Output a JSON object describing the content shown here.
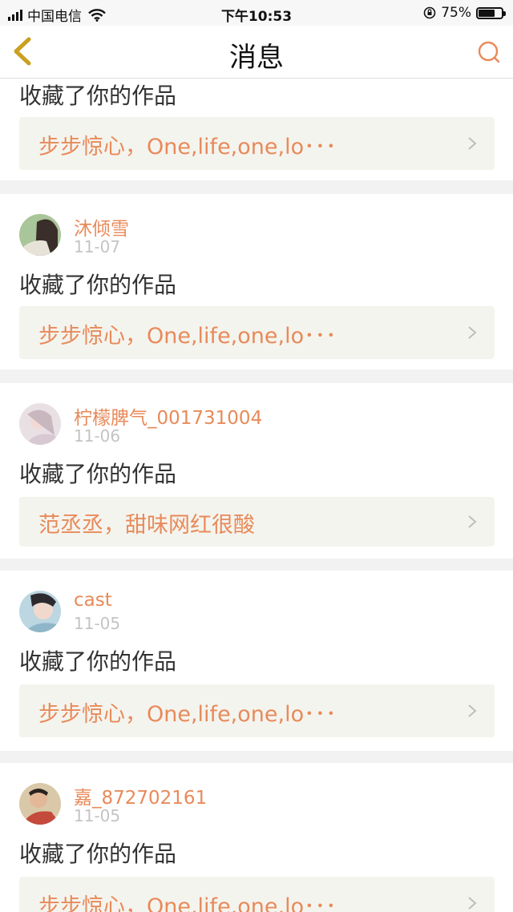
{
  "status": {
    "carrier": "中国电信",
    "time": "下午10:53",
    "battery": "75%",
    "battery_level": 0.75
  },
  "nav": {
    "title": "消息",
    "back_icon": "chevron-left-icon",
    "search_icon": "search-icon"
  },
  "colors": {
    "accent": "#e88a5a",
    "back": "#c9a020",
    "card_bg": "#f4f4ee",
    "page_bg": "#f2f2f2"
  },
  "notifications": [
    {
      "user": "",
      "date": "",
      "action": "收藏了你的作品",
      "work": "步步惊心，One,life,one,lo･･･"
    },
    {
      "user": "沐倾雪",
      "date": "11-07",
      "action": "收藏了你的作品",
      "work": "步步惊心，One,life,one,lo･･･"
    },
    {
      "user": "柠檬脾气_001731004",
      "date": "11-06",
      "action": "收藏了你的作品",
      "work": "范丞丞，甜味网红很酸"
    },
    {
      "user": "cast",
      "date": "11-05",
      "action": "收藏了你的作品",
      "work": "步步惊心，One,life,one,lo･･･"
    },
    {
      "user": "嘉_872702161",
      "date": "11-05",
      "action": "收藏了你的作品",
      "work": "步步惊心，One,life,one,lo･･･"
    }
  ]
}
